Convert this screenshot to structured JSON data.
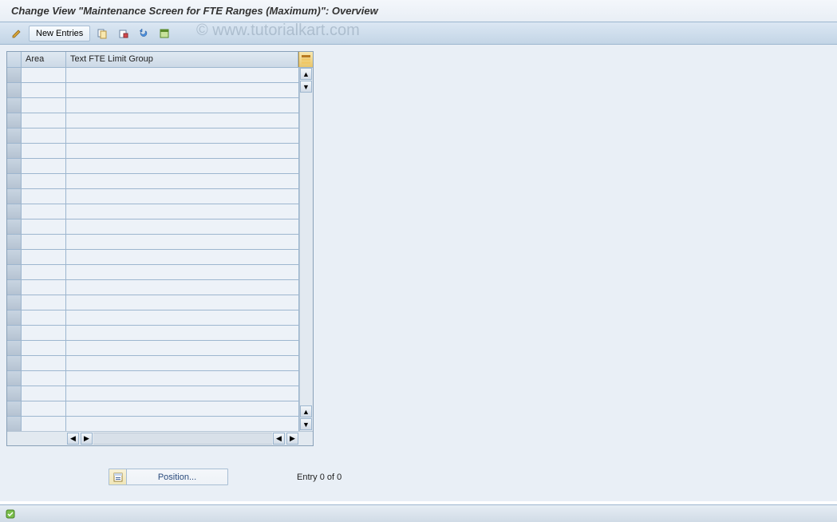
{
  "title": "Change View \"Maintenance Screen for FTE Ranges (Maximum)\": Overview",
  "watermark": "© www.tutorialkart.com",
  "toolbar": {
    "new_entries_label": "New Entries"
  },
  "grid": {
    "columns": {
      "area": "Area",
      "text_fte": "Text FTE Limit Group"
    },
    "row_count": 24
  },
  "footer": {
    "position_label": "Position...",
    "entry_label": "Entry 0 of 0"
  },
  "colors": {
    "header_grad_top": "#f4f7fb",
    "toolbar_grad_top": "#dbe7f3",
    "border": "#9db6cf"
  }
}
